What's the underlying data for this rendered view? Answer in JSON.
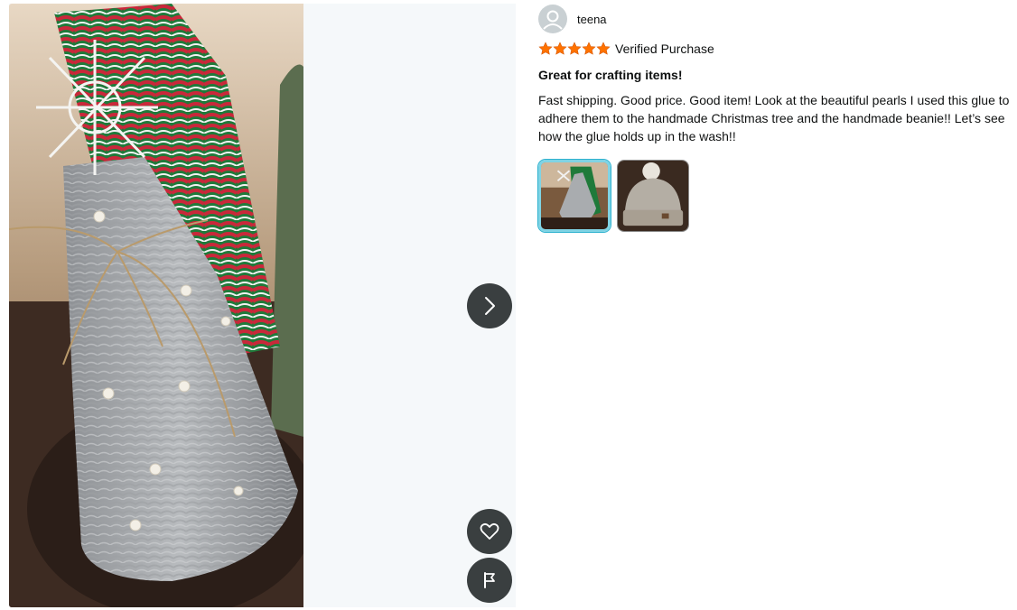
{
  "reviewer": {
    "name": "teena",
    "avatar_icon": "user-avatar-icon"
  },
  "review": {
    "rating": 5,
    "rating_max": 5,
    "star_color": "#ff7200",
    "verified_label": "Verified Purchase",
    "title": "Great for crafting items!",
    "body_lines": [
      "Fast shipping. Good price. Good item! Look at the beautiful pearls I used this glue to",
      "adhere them to the handmade Christmas tree and the handmade beanie!! Let’s see",
      "how the glue holds up in the wash!!"
    ]
  },
  "media": {
    "selected_index": 0,
    "thumbnails": [
      {
        "name": "crocheted christmas tree photo"
      },
      {
        "name": "knit beanie photo"
      }
    ]
  },
  "controls": {
    "next_icon": "chevron-right-icon",
    "like_icon": "heart-icon",
    "report_icon": "flag-icon"
  },
  "colors": {
    "button_bg": "#3a3f40",
    "viewer_bg": "#f5f8fa",
    "thumb_selected_border": "#7fd3e4"
  }
}
